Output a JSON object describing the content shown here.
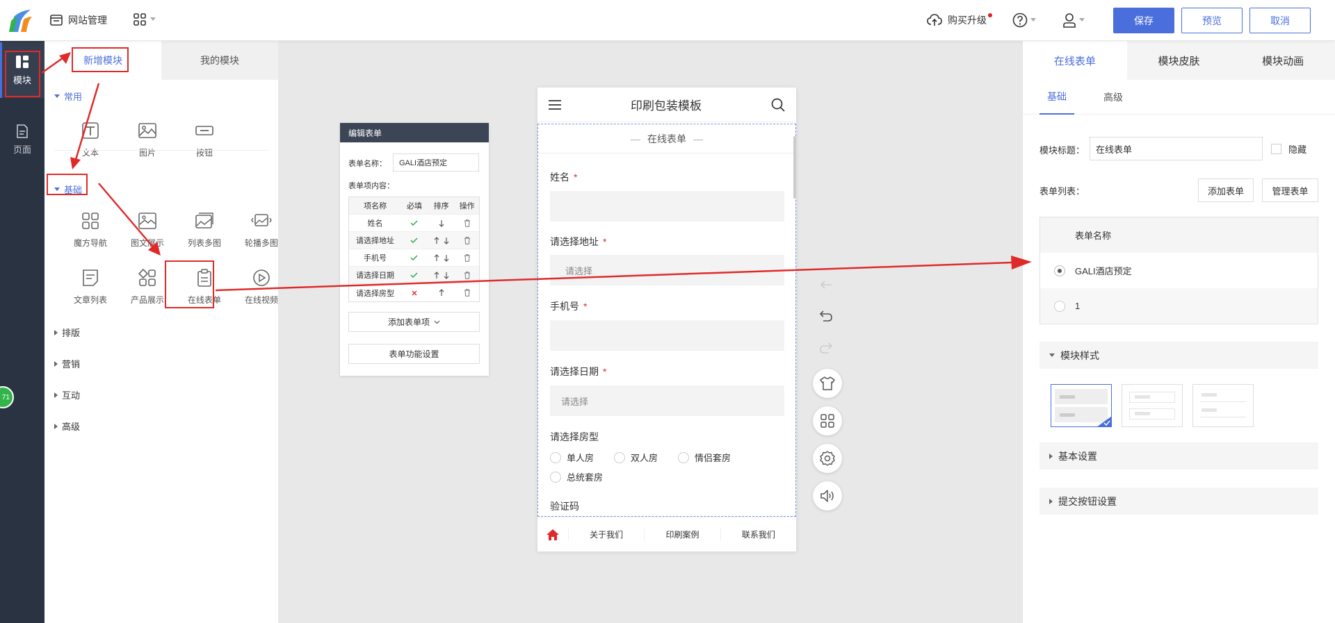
{
  "topbar": {
    "site_manage": "网站管理",
    "buy_upgrade": "购买升级",
    "save": "保存",
    "preview": "预览",
    "cancel": "取消"
  },
  "leftnav": {
    "items": [
      {
        "label": "模块",
        "icon": "module-icon",
        "active": true
      },
      {
        "label": "页面",
        "icon": "page-icon",
        "active": false
      }
    ],
    "badge": "71"
  },
  "module_panel": {
    "tabs": [
      "新增模块",
      "我的模块"
    ],
    "categories": {
      "common": "常用",
      "basic": "基础",
      "layout": "排版",
      "marketing": "营销",
      "interactive": "互动",
      "advanced": "高级"
    },
    "common_items": [
      "文本",
      "图片",
      "按钮"
    ],
    "basic_items": [
      "魔方导航",
      "图文展示",
      "列表多图",
      "轮播多图",
      "文章列表",
      "产品展示",
      "在线表单",
      "在线视频"
    ]
  },
  "edit_form": {
    "title": "编辑表单",
    "name_label": "表单名称：",
    "name_value": "GALI酒店预定",
    "content_label": "表单项内容：",
    "columns": [
      "项名称",
      "必填",
      "排序",
      "操作"
    ],
    "rows": [
      "姓名",
      "请选择地址",
      "手机号",
      "请选择日期",
      "请选择房型"
    ],
    "add_item": "添加表单项",
    "settings": "表单功能设置"
  },
  "phone": {
    "title": "印刷包装模板",
    "form_title": "在线表单",
    "fields": {
      "name": "姓名",
      "address": "请选择地址",
      "phone": "手机号",
      "date": "请选择日期",
      "room": "请选择房型",
      "captcha": "验证码"
    },
    "placeholder": "请选择",
    "room_options": [
      "单人房",
      "双人房",
      "情侣套房",
      "总统套房"
    ],
    "footer": [
      "关于我们",
      "印刷案例",
      "联系我们"
    ]
  },
  "right_panel": {
    "tabs": [
      "在线表单",
      "模块皮肤",
      "模块动画"
    ],
    "subtabs": [
      "基础",
      "高级"
    ],
    "title_label": "模块标题：",
    "title_value": "在线表单",
    "hide_label": "隐藏",
    "list_label": "表单列表：",
    "add_form": "添加表单",
    "manage_form": "管理表单",
    "table_header": "表单名称",
    "forms": [
      "GALI酒店预定",
      "1"
    ],
    "sections": [
      "模块样式",
      "基本设置",
      "提交按钮设置"
    ]
  },
  "colors": {
    "accent": "#4a6fdc",
    "nav_bg": "#2a3342",
    "annotation": "#e02a2a",
    "check": "#2fa84f"
  }
}
